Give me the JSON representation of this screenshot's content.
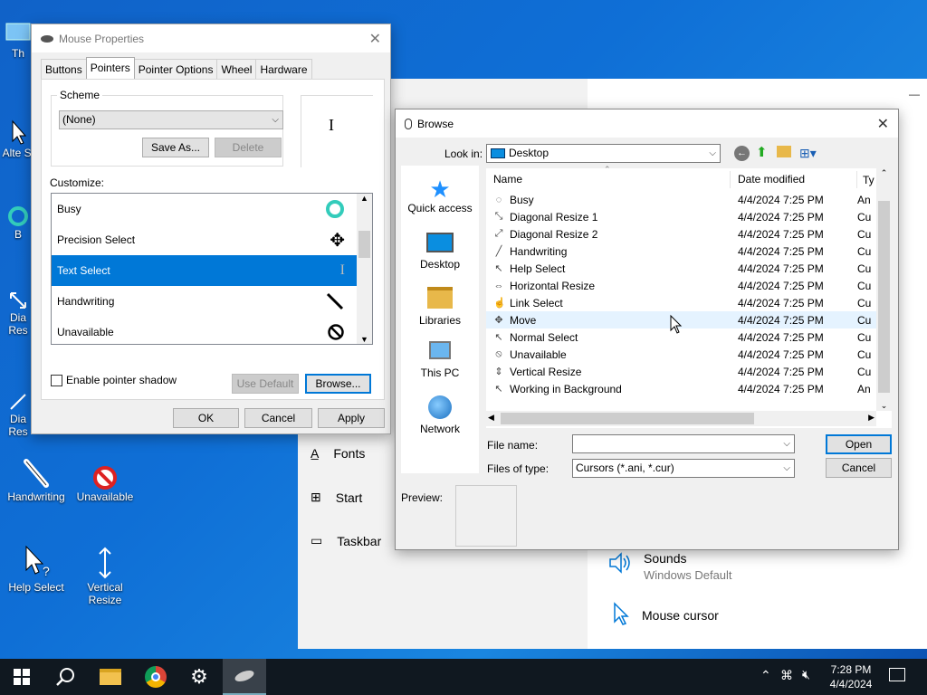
{
  "desktop": {
    "icons": [
      {
        "label": "Th",
        "icon": "this-pc-icon"
      },
      {
        "label": "Alte Se",
        "icon": "cursor-icon"
      },
      {
        "label": "B",
        "icon": "busy-icon"
      },
      {
        "label": "Dia Res",
        "icon": "diagonal-resize-icon"
      },
      {
        "label": "Dia Res",
        "icon": "diagonal-resize-icon"
      },
      {
        "label": "Handwriting",
        "icon": "pen-icon"
      },
      {
        "label": "Unavailable",
        "icon": "unavailable-icon"
      },
      {
        "label": "Help Select",
        "icon": "help-select-icon"
      },
      {
        "label": "Vertical Resize",
        "icon": "vertical-resize-icon"
      }
    ]
  },
  "settings": {
    "nav": [
      {
        "label": "Fonts",
        "icon": "fonts-icon"
      },
      {
        "label": "Start",
        "icon": "start-icon"
      },
      {
        "label": "Taskbar",
        "icon": "taskbar-icon"
      }
    ],
    "sounds": {
      "title": "Sounds",
      "subtitle": "Windows Default"
    },
    "mouse_cursor": "Mouse cursor"
  },
  "mouse_properties": {
    "title": "Mouse Properties",
    "tabs": [
      "Buttons",
      "Pointers",
      "Pointer Options",
      "Wheel",
      "Hardware"
    ],
    "active_tab": "Pointers",
    "scheme_label": "Scheme",
    "scheme_value": "(None)",
    "save_as": "Save As...",
    "delete": "Delete",
    "customize_label": "Customize:",
    "pointers": [
      {
        "name": "Busy",
        "selected": false
      },
      {
        "name": "Precision Select",
        "selected": false
      },
      {
        "name": "Text Select",
        "selected": true
      },
      {
        "name": "Handwriting",
        "selected": false
      },
      {
        "name": "Unavailable",
        "selected": false
      }
    ],
    "enable_shadow": "Enable pointer shadow",
    "use_default": "Use Default",
    "browse": "Browse...",
    "ok": "OK",
    "cancel": "Cancel",
    "apply": "Apply"
  },
  "browse": {
    "title": "Browse",
    "look_in_label": "Look in:",
    "look_in_value": "Desktop",
    "places": [
      "Quick access",
      "Desktop",
      "Libraries",
      "This PC",
      "Network"
    ],
    "columns": [
      "Name",
      "Date modified",
      "Ty"
    ],
    "files": [
      {
        "name": "Busy",
        "date": "4/4/2024 7:25 PM",
        "type": "An"
      },
      {
        "name": "Diagonal Resize 1",
        "date": "4/4/2024 7:25 PM",
        "type": "Cu"
      },
      {
        "name": "Diagonal Resize 2",
        "date": "4/4/2024 7:25 PM",
        "type": "Cu"
      },
      {
        "name": "Handwriting",
        "date": "4/4/2024 7:25 PM",
        "type": "Cu"
      },
      {
        "name": "Help Select",
        "date": "4/4/2024 7:25 PM",
        "type": "Cu"
      },
      {
        "name": "Horizontal Resize",
        "date": "4/4/2024 7:25 PM",
        "type": "Cu"
      },
      {
        "name": "Link Select",
        "date": "4/4/2024 7:25 PM",
        "type": "Cu"
      },
      {
        "name": "Move",
        "date": "4/4/2024 7:25 PM",
        "type": "Cu"
      },
      {
        "name": "Normal Select",
        "date": "4/4/2024 7:25 PM",
        "type": "Cu"
      },
      {
        "name": "Unavailable",
        "date": "4/4/2024 7:25 PM",
        "type": "Cu"
      },
      {
        "name": "Vertical Resize",
        "date": "4/4/2024 7:25 PM",
        "type": "Cu"
      },
      {
        "name": "Working in Background",
        "date": "4/4/2024 7:25 PM",
        "type": "An"
      }
    ],
    "file_name_label": "File name:",
    "file_name_value": "",
    "files_of_type_label": "Files of type:",
    "files_of_type_value": "Cursors (*.ani, *.cur)",
    "open": "Open",
    "cancel": "Cancel",
    "preview_label": "Preview:"
  },
  "taskbar": {
    "time": "7:28 PM",
    "date": "4/4/2024"
  },
  "colors": {
    "accent": "#0078d7",
    "taskbar": "#101820"
  }
}
